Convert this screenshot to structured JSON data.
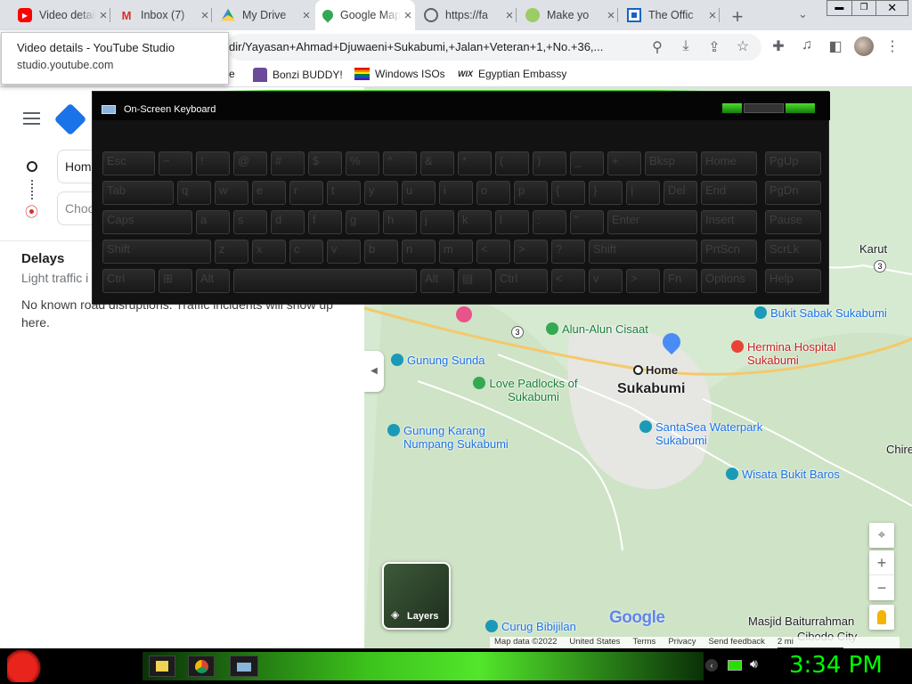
{
  "browser": {
    "tabs": [
      {
        "title": "Video details - YouTube Studio",
        "favicon": "youtube-icon"
      },
      {
        "title": "Inbox (7)",
        "favicon": "gmail-icon"
      },
      {
        "title": "My Drive",
        "favicon": "drive-icon"
      },
      {
        "title": "Google Maps",
        "favicon": "maps-icon",
        "active": true
      },
      {
        "title": "https://fa",
        "favicon": "globe-icon"
      },
      {
        "title": "Make yo",
        "favicon": "make-icon"
      },
      {
        "title": "The Offic",
        "favicon": "office-icon"
      }
    ],
    "new_tab": "+",
    "url": "dir/Yayasan+Ahmad+Djuwaeni+Sukabumi,+Jalan+Veteran+1,+No.+36,...",
    "bookmarks": [
      {
        "label": "e",
        "icon": "none"
      },
      {
        "label": "Bonzi BUDDY!",
        "icon": "bonzi-icon"
      },
      {
        "label": "Windows ISOs",
        "icon": "rainbow-flag-icon"
      },
      {
        "label": "Egyptian Embassy",
        "icon": "wix-icon"
      }
    ],
    "bookmark_wix": "WIX",
    "tooltip": {
      "title": "Video details - YouTube Studio",
      "domain": "studio.youtube.com"
    }
  },
  "maps_panel": {
    "origin_value": "Hom",
    "destination_placeholder": "Choo",
    "delays_heading": "Delays",
    "delays_sub": "Light traffic i",
    "notice": "No known road disruptions. Traffic incidents will show up here."
  },
  "map": {
    "places": [
      {
        "name": "Bukit Sabak Sukabumi"
      },
      {
        "name": "Alun-Alun Cisaat"
      },
      {
        "name": "Hermina Hospital Sukabumi"
      },
      {
        "name": "Gunung Sunda"
      },
      {
        "name": "Home"
      },
      {
        "name": "Love Padlocks of Sukabumi"
      },
      {
        "name": "Sukabumi"
      },
      {
        "name": "SantaSea Waterpark Sukabumi"
      },
      {
        "name": "Gunung Karang Numpang Sukabumi"
      },
      {
        "name": "Wisata Bukit Baros"
      },
      {
        "name": "Curug Bibijilan"
      },
      {
        "name": "Masjid Baiturrahman"
      },
      {
        "name": "Cibodo City"
      },
      {
        "name": "Karut"
      },
      {
        "name": "Chire"
      }
    ],
    "road_number": "3",
    "layers_label": "Layers",
    "google_logo": "Google",
    "footer": [
      "Map data ©2022",
      "United States",
      "Terms",
      "Privacy",
      "Send feedback",
      "2 mi"
    ],
    "zoom_in": "+",
    "zoom_out": "−"
  },
  "osk": {
    "title": "On-Screen Keyboard",
    "rows": [
      [
        "Esc",
        "~",
        "!",
        "@",
        "#",
        "$",
        "%",
        "^",
        "&",
        "*",
        "(",
        ")",
        "_",
        "+",
        "Bksp",
        "Home",
        "PgUp"
      ],
      [
        "Tab",
        "q",
        "w",
        "e",
        "r",
        "t",
        "y",
        "u",
        "i",
        "o",
        "p",
        "{",
        "}",
        "|",
        "Del",
        "End",
        "PgDn"
      ],
      [
        "Caps",
        "a",
        "s",
        "d",
        "f",
        "g",
        "h",
        "j",
        "k",
        "l",
        ":",
        "\"",
        "Enter",
        "Insert",
        "Pause"
      ],
      [
        "Shift",
        "z",
        "x",
        "c",
        "v",
        "b",
        "n",
        "m",
        "<",
        ">",
        "?",
        "Shift",
        "PrtScn",
        "ScrLk"
      ],
      [
        "Ctrl",
        "⊞",
        "Alt",
        "",
        "Alt",
        "▤",
        "Ctrl",
        "<",
        "v",
        ">",
        "Fn",
        "Options",
        "Help"
      ]
    ]
  },
  "taskbar": {
    "clock": "3:34 PM",
    "clock_color": "#00ff00",
    "accent": "#28e000"
  }
}
